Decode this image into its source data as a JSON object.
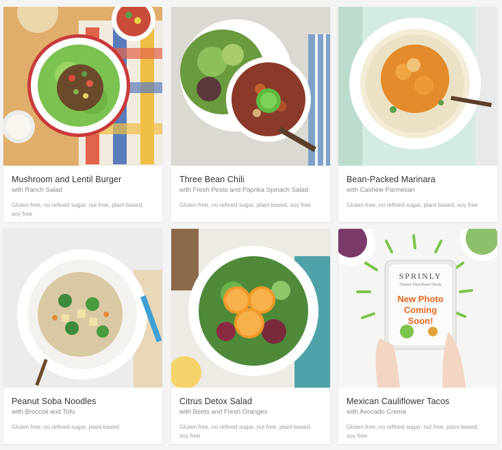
{
  "recipes": [
    {
      "title": "Mushroom and Lentil Burger",
      "subtitle": "with Ranch Salad",
      "tags": "Gluten free, no refined sugar, nut free, plant-based, soy free"
    },
    {
      "title": "Three Bean Chili",
      "subtitle": "with Fresh Pesto and Paprika Spinach Salad",
      "tags": "Gluten free, no refined sugar, plant-based, soy free"
    },
    {
      "title": "Bean-Packed Marinara",
      "subtitle": "with Cashew Parmesan",
      "tags": "Gluten free, no refined sugar, plant-based, soy free"
    },
    {
      "title": "Peanut Soba Noodles",
      "subtitle": "with Broccoli and Tofu",
      "tags": "Gluten free, no refined sugar, plant-based"
    },
    {
      "title": "Citrus Detox Salad",
      "subtitle": "with Beets and Fresh Oranges",
      "tags": "Gluten free, no refined sugar, nut free, plant-based, soy free"
    },
    {
      "title": "Mexican Cauliflower Tacos",
      "subtitle": "with Avocado Crema",
      "tags": "Gluten free, no refined sugar, nut free, plant-based, soy free"
    }
  ],
  "placeholder": {
    "brand": "SPRINLY",
    "tagline": "Organic Plant-Based Meals",
    "message_line1": "New Photo",
    "message_line2": "Coming",
    "message_line3": "Soon!"
  }
}
